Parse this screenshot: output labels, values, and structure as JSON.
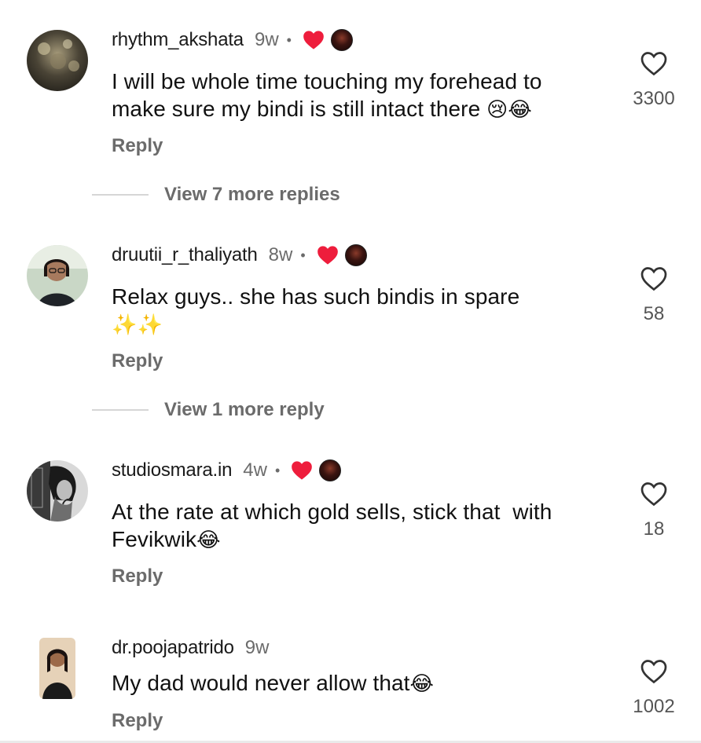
{
  "comments": [
    {
      "username": "rhythm_akshata",
      "time": "9w",
      "separator": "•",
      "text_line1": "I will be whole time touching my forehead to",
      "text_line2": "make sure my bindi is still intact there ",
      "text_line2_emoji": "😢😂",
      "reply_label": "Reply",
      "like_count": "3300",
      "view_more": "View 7 more replies",
      "creator_liked": true
    },
    {
      "username": "druutii_r_thaliyath",
      "time": "8w",
      "separator": "•",
      "text_line1": "Relax guys.. she has such bindis in spare",
      "text_line2": "",
      "text_line2_emoji": "✨✨",
      "reply_label": "Reply",
      "like_count": "58",
      "view_more": "View 1 more reply",
      "creator_liked": true
    },
    {
      "username": "studiosmara.in",
      "time": "4w",
      "separator": "•",
      "text_line1": "At the rate at which gold sells, stick that  with",
      "text_line2": "Fevikwik",
      "text_line2_emoji": "😂",
      "reply_label": "Reply",
      "like_count": "18",
      "creator_liked": true
    },
    {
      "username": "dr.poojapatrido",
      "time": "9w",
      "text_line1": "My dad would never allow that",
      "text_line1_emoji": "😂",
      "reply_label": "Reply",
      "like_count": "1002",
      "creator_liked": false
    }
  ],
  "icons": {
    "like": "heart-outline-icon",
    "creator_like": "heart-filled-icon",
    "creator_like_color": "#ee1d3c"
  }
}
